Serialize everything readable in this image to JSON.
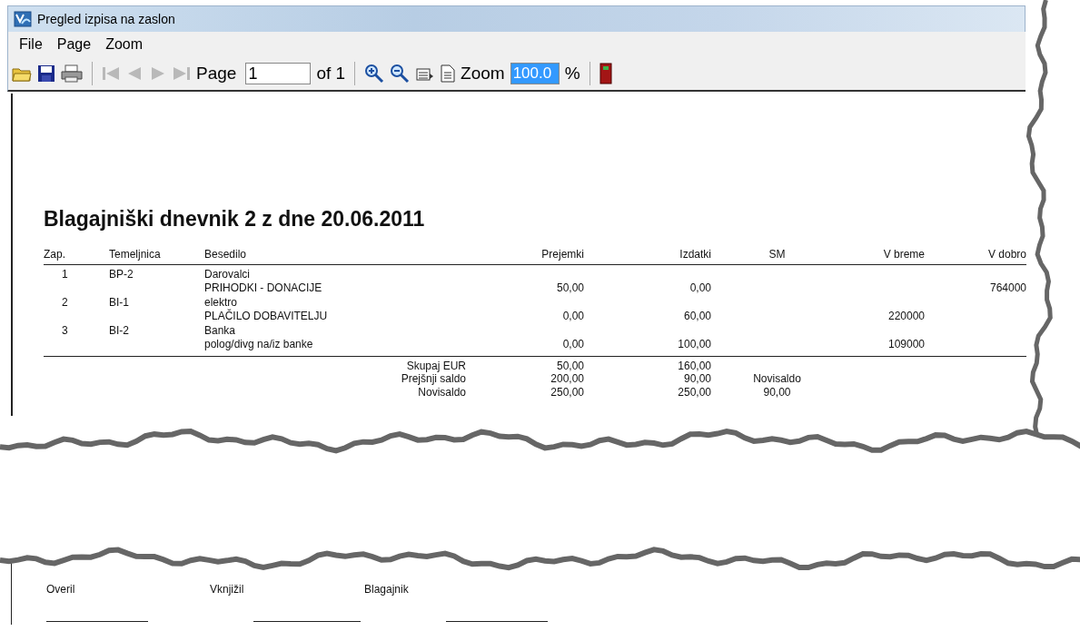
{
  "window": {
    "title": "Pregled izpisa na zaslon"
  },
  "menu": [
    "File",
    "Page",
    "Zoom"
  ],
  "toolbar": {
    "navigation": {
      "disabled": true
    },
    "page_label": "Page",
    "page_value": "1",
    "page_of": "of 1",
    "zoom_label": "Zoom",
    "zoom_field": {
      "value": "100.0",
      "text_selected": true
    },
    "zoom_unit": "%"
  },
  "report": {
    "title": "Blagajniški dnevnik 2 z dne 20.06.2011",
    "columns": [
      "Zap.",
      "Temeljnica",
      "Besedilo",
      "Prejemki",
      "Izdatki",
      "SM",
      "V breme",
      "V dobro"
    ],
    "rows": [
      {
        "zap": "1",
        "temeljnica": "BP-2",
        "besedilo": [
          "Darovalci",
          "PRIHODKI - DONACIJE"
        ],
        "prejemki": "50,00",
        "izdatki": "0,00",
        "v_dobro": "764000"
      },
      {
        "zap": "2",
        "temeljnica": "BI-1",
        "besedilo": [
          "elektro",
          "PLAČILO DOBAVITELJU"
        ],
        "prejemki": "0,00",
        "izdatki": "60,00",
        "v_breme": "220000"
      },
      {
        "zap": "3",
        "temeljnica": "BI-2",
        "besedilo": [
          "Banka",
          "polog/divg na/iz banke"
        ],
        "prejemki": "0,00",
        "izdatki": "100,00",
        "v_breme": "109000"
      }
    ],
    "totals": [
      {
        "label": "Skupaj EUR",
        "prejemki": "50,00",
        "izdatki": "160,00"
      },
      {
        "label": "Prejšnji saldo",
        "prejemki": "200,00",
        "izdatki": "90,00",
        "sm": "Novisaldo"
      },
      {
        "label": "Novisaldo",
        "prejemki": "250,00",
        "izdatki": "250,00",
        "sm": "90,00"
      }
    ],
    "signatures": [
      "Overil",
      "Vknjižil",
      "Blagajnik"
    ]
  }
}
